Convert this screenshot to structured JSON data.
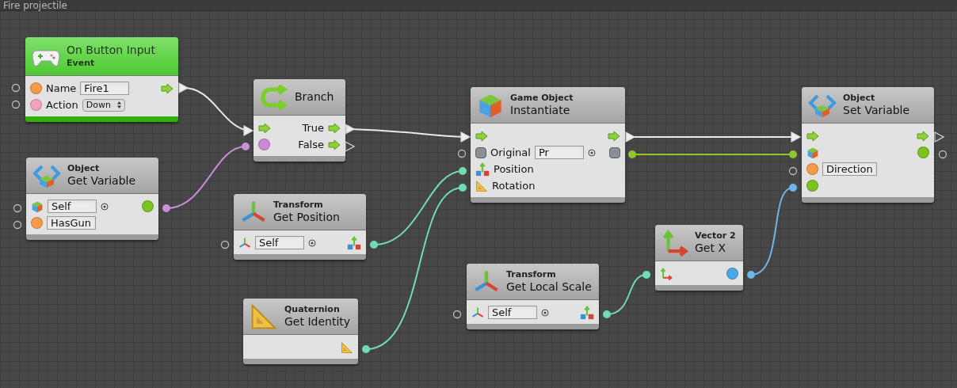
{
  "graph": {
    "title": "Fire projectile"
  },
  "nodes": [
    {
      "kind": "event",
      "title": "On Button Input",
      "category": "Event",
      "rows": [
        {
          "kind": "string",
          "label": "Name",
          "value": "Fire1",
          "output": {
            "kind": "flow"
          }
        },
        {
          "kind": "enum",
          "label": "Action",
          "dropdown": "Down"
        }
      ]
    },
    {
      "kind": "branch",
      "title": "Branch",
      "rows": [
        {
          "kind": "flow",
          "label": "True",
          "output": {
            "kind": "flow"
          }
        },
        {
          "kind": "bool",
          "label": "False",
          "output": {
            "kind": "flow"
          }
        }
      ]
    },
    {
      "kind": "variable",
      "category": "Object",
      "title": "Get Variable",
      "rows": [
        {
          "kind": "object",
          "value": "Self",
          "output": {
            "kind": "value"
          }
        },
        {
          "kind": "string",
          "value": "HasGun"
        }
      ]
    },
    {
      "kind": "transform",
      "category": "Transform",
      "title": "Get Position",
      "rows": [
        {
          "kind": "transform",
          "value": "Self",
          "output": {
            "kind": "vector3"
          }
        }
      ]
    },
    {
      "kind": "cube",
      "category": "Game Object",
      "title": "Instantiate",
      "rows": [
        {
          "kind": "flow",
          "output": {
            "kind": "flow"
          }
        },
        {
          "kind": "gameobject",
          "label": "Original",
          "value": "Pr",
          "output": {
            "kind": "gameobject"
          }
        },
        {
          "kind": "vector3",
          "label": "Position"
        },
        {
          "kind": "quaternion",
          "label": "Rotation"
        }
      ]
    },
    {
      "kind": "variable",
      "category": "Object",
      "title": "Set Variable",
      "rows": [
        {
          "kind": "flow",
          "output": {
            "kind": "flow"
          }
        },
        {
          "kind": "object",
          "output": {
            "kind": "value"
          }
        },
        {
          "kind": "string",
          "value": "Direction"
        },
        {
          "kind": "value"
        }
      ]
    },
    {
      "kind": "ruler",
      "category": "Quaternion",
      "title": "Get Identity",
      "rows": [
        {
          "kind": "empty",
          "output": {
            "kind": "quaternion"
          }
        }
      ]
    },
    {
      "kind": "transform",
      "category": "Transform",
      "title": "Get Local Scale",
      "rows": [
        {
          "kind": "transform",
          "value": "Self",
          "output": {
            "kind": "vector3"
          }
        }
      ]
    },
    {
      "kind": "vector2",
      "category": "Vector 2",
      "title": "Get X",
      "rows": [
        {
          "kind": "vector2",
          "output": {
            "kind": "float"
          }
        }
      ]
    }
  ]
}
